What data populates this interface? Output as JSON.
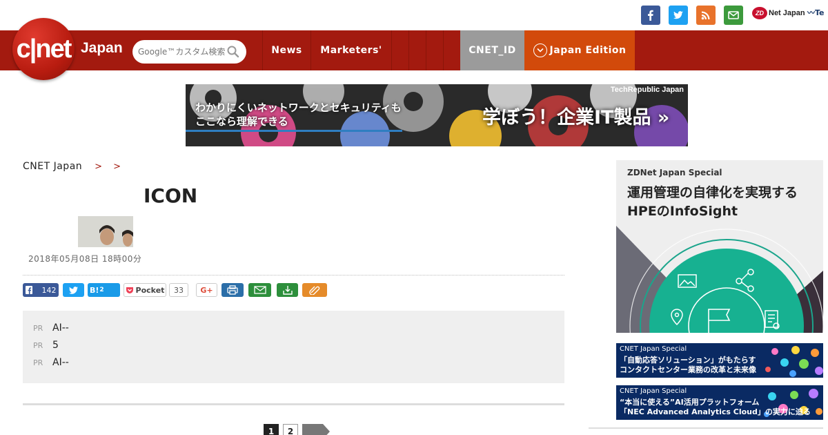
{
  "topbar": {
    "social": [
      "facebook-icon",
      "twitter-icon",
      "rss-icon",
      "mail-icon"
    ],
    "zdnet": "Net Japan",
    "zdnet_mark": "ZD",
    "techrepublic": "Te"
  },
  "nav": {
    "logo": "c|net",
    "logo_sub": "Japan",
    "search_placeholder": "Google™カスタム検索",
    "items": [
      "News",
      "Marketers'"
    ],
    "cnet_id": "CNET_ID",
    "edition": "Japan Edition",
    "colors": {
      "bar": "#a31a0f",
      "cnet_id": "#9b9b9b",
      "edition": "#d24a0b"
    }
  },
  "banner": {
    "brand": "TechRepublic Japan",
    "line1": "わかりにくいネットワークとセキュリティも",
    "line2": "ここなら理解できる",
    "cta": "学ぼう！企業IT製品 »"
  },
  "breadcrumb": {
    "home": "CNET Japan",
    "sep": ">",
    "level1": "",
    "level2": ""
  },
  "article": {
    "title": "ICON",
    "author": "",
    "date": "2018年05月08日 18時00分"
  },
  "share": {
    "facebook_count": "142",
    "hatena_label": "B!",
    "hatena_count": "2",
    "pocket_label": "Pocket",
    "pocket_count": "33",
    "gplus_label": "G+"
  },
  "pr": {
    "tag": "PR",
    "items": [
      "AI--",
      "5",
      "AI--"
    ]
  },
  "pagination": {
    "page1": "1",
    "page2": "2"
  },
  "sidebar": {
    "hpe_kicker": "ZDNet Japan Special",
    "hpe_line1": "運用管理の自律化を実現する",
    "hpe_line2": "HPEのInfoSight",
    "ad1_kicker": "CNET Japan Special",
    "ad1_line1": "「自動応答ソリューション」がもたらす",
    "ad1_line2": "コンタクトセンター業務の改革と未来像",
    "ad2_kicker": "CNET Japan Special",
    "ad2_line1": "“本当に使える”AI活用プラットフォーム",
    "ad2_line2": "「NEC Advanced Analytics Cloud」の実力に迫る"
  }
}
